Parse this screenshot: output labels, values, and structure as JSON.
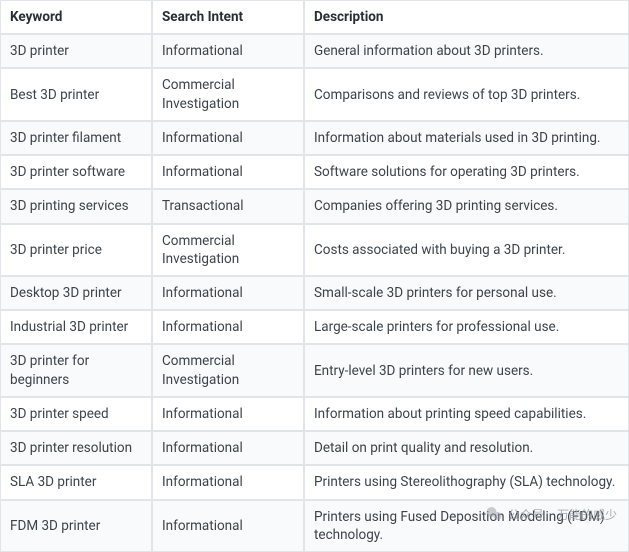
{
  "columns": [
    "Keyword",
    "Search Intent",
    "Description"
  ],
  "rows": [
    {
      "keyword": "3D printer",
      "intent": "Informational",
      "description": "General information about 3D printers."
    },
    {
      "keyword": "Best 3D printer",
      "intent": "Commercial Investigation",
      "description": "Comparisons and reviews of top 3D printers."
    },
    {
      "keyword": "3D printer filament",
      "intent": "Informational",
      "description": "Information about materials used in 3D printing."
    },
    {
      "keyword": "3D printer software",
      "intent": "Informational",
      "description": "Software solutions for operating 3D printers."
    },
    {
      "keyword": "3D printing services",
      "intent": "Transactional",
      "description": "Companies offering 3D printing services."
    },
    {
      "keyword": "3D printer price",
      "intent": "Commercial Investigation",
      "description": "Costs associated with buying a 3D printer."
    },
    {
      "keyword": "Desktop 3D printer",
      "intent": "Informational",
      "description": "Small-scale 3D printers for personal use."
    },
    {
      "keyword": "Industrial 3D printer",
      "intent": "Informational",
      "description": "Large-scale printers for professional use."
    },
    {
      "keyword": "3D printer for beginners",
      "intent": "Commercial Investigation",
      "description": "Entry-level 3D printers for new users."
    },
    {
      "keyword": "3D printer speed",
      "intent": "Informational",
      "description": "Information about printing speed capabilities."
    },
    {
      "keyword": "3D printer resolution",
      "intent": "Informational",
      "description": "Detail on print quality and resolution."
    },
    {
      "keyword": "SLA 3D printer",
      "intent": "Informational",
      "description": "Printers using Stereolithography (SLA) technology."
    },
    {
      "keyword": "FDM 3D printer",
      "intent": "Informational",
      "description": "Printers using Fused Deposition Modeling (FDM) technology."
    }
  ],
  "watermark": {
    "label": "公众号",
    "author": "万能的威少"
  },
  "chart_data": {
    "type": "table",
    "columns": [
      "Keyword",
      "Search Intent",
      "Description"
    ],
    "rows": [
      [
        "3D printer",
        "Informational",
        "General information about 3D printers."
      ],
      [
        "Best 3D printer",
        "Commercial Investigation",
        "Comparisons and reviews of top 3D printers."
      ],
      [
        "3D printer filament",
        "Informational",
        "Information about materials used in 3D printing."
      ],
      [
        "3D printer software",
        "Informational",
        "Software solutions for operating 3D printers."
      ],
      [
        "3D printing services",
        "Transactional",
        "Companies offering 3D printing services."
      ],
      [
        "3D printer price",
        "Commercial Investigation",
        "Costs associated with buying a 3D printer."
      ],
      [
        "Desktop 3D printer",
        "Informational",
        "Small-scale 3D printers for personal use."
      ],
      [
        "Industrial 3D printer",
        "Informational",
        "Large-scale printers for professional use."
      ],
      [
        "3D printer for beginners",
        "Commercial Investigation",
        "Entry-level 3D printers for new users."
      ],
      [
        "3D printer speed",
        "Informational",
        "Information about printing speed capabilities."
      ],
      [
        "3D printer resolution",
        "Informational",
        "Detail on print quality and resolution."
      ],
      [
        "SLA 3D printer",
        "Informational",
        "Printers using Stereolithography (SLA) technology."
      ],
      [
        "FDM 3D printer",
        "Informational",
        "Printers using Fused Deposition Modeling (FDM) technology."
      ]
    ]
  }
}
